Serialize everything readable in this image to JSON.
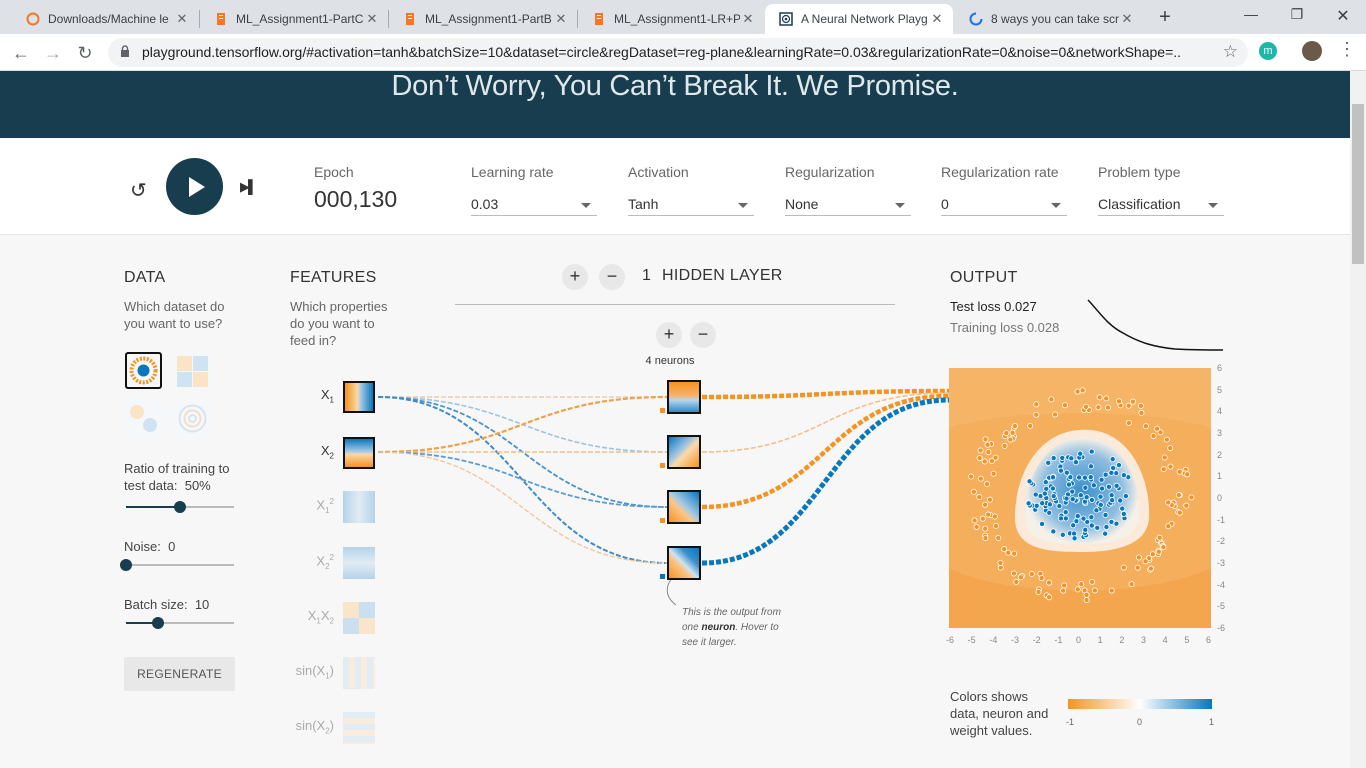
{
  "browser": {
    "tabs": [
      {
        "title": "Downloads/Machine le",
        "icon": "loading-ring-icon"
      },
      {
        "title": "ML_Assignment1-PartC",
        "icon": "jupyter-notebook-icon"
      },
      {
        "title": "ML_Assignment1-PartB",
        "icon": "jupyter-notebook-icon"
      },
      {
        "title": "ML_Assignment1-LR+Pl",
        "icon": "jupyter-notebook-icon"
      },
      {
        "title": "A Neural Network Playg",
        "icon": "playground-icon"
      },
      {
        "title": "8 ways you can take scr",
        "icon": "loading-spinner-icon"
      }
    ],
    "close_glyph": "✕",
    "new_tab_glyph": "+",
    "url": "playground.tensorflow.org/#activation=tanh&batchSize=10&dataset=circle&regDataset=reg-plane&learningRate=0.03&regularizationRate=0&noise=0&networkShape=...",
    "extension_letter": "m"
  },
  "banner": {
    "text": "Don’t Worry, You Can’t Break It. We Promise."
  },
  "controls": {
    "epoch_label": "Epoch",
    "epoch_value": "000,130",
    "learning_rate": {
      "label": "Learning rate",
      "value": "0.03"
    },
    "activation": {
      "label": "Activation",
      "value": "Tanh"
    },
    "regularization": {
      "label": "Regularization",
      "value": "None"
    },
    "regularization_rate": {
      "label": "Regularization rate",
      "value": "0"
    },
    "problem_type": {
      "label": "Problem type",
      "value": "Classification"
    }
  },
  "data_panel": {
    "heading": "DATA",
    "question": "Which dataset do you want to use?",
    "datasets": [
      "circle",
      "xor",
      "gaussian",
      "spiral"
    ],
    "selected_dataset": "circle",
    "ratio_label": "Ratio of training to test data:",
    "ratio_value": "50%",
    "ratio_fraction": 0.5,
    "noise_label": "Noise:",
    "noise_value": "0",
    "noise_fraction": 0,
    "batch_label": "Batch size:",
    "batch_value": "10",
    "batch_fraction": 0.3,
    "regenerate": "REGENERATE"
  },
  "features_panel": {
    "heading": "FEATURES",
    "question": "Which properties do you want to feed in?",
    "features": [
      {
        "label": "X1",
        "sub": "1",
        "sup": "",
        "base": "X",
        "active": true
      },
      {
        "label": "X2",
        "sub": "2",
        "sup": "",
        "base": "X",
        "active": true
      },
      {
        "label": "X1^2",
        "sub": "1",
        "sup": "2",
        "base": "X",
        "active": false
      },
      {
        "label": "X2^2",
        "sub": "2",
        "sup": "2",
        "base": "X",
        "active": false
      },
      {
        "label": "X1X2",
        "sub": "",
        "sup": "",
        "base": "X1X2",
        "active": false
      },
      {
        "label": "sin(X1)",
        "sub": "",
        "sup": "",
        "base": "sin(X1)",
        "active": false
      },
      {
        "label": "sin(X2)",
        "sub": "",
        "sup": "",
        "base": "sin(X2)",
        "active": false
      }
    ]
  },
  "network": {
    "hidden_layer_count": "1",
    "hidden_layer_text": "HIDDEN LAYER",
    "add_glyph": "+",
    "remove_glyph": "−",
    "neurons_text": "4 neurons",
    "callout": {
      "line1": "This is the output from one",
      "bold": "neuron",
      "line2": ". Hover to see it larger."
    }
  },
  "output_panel": {
    "heading": "OUTPUT",
    "test_loss": "Test loss 0.027",
    "training_loss": "Training loss 0.028",
    "axis_ticks": [
      "-6",
      "-5",
      "-4",
      "-3",
      "-2",
      "-1",
      "0",
      "1",
      "2",
      "3",
      "4",
      "5",
      "6"
    ],
    "legend_text": "Colors shows data, neuron and weight values.",
    "legend_ticks": [
      "-1",
      "0",
      "1"
    ]
  },
  "colors": {
    "orange": "#f59322",
    "blue": "#0877bd",
    "navy": "#183d4e"
  }
}
